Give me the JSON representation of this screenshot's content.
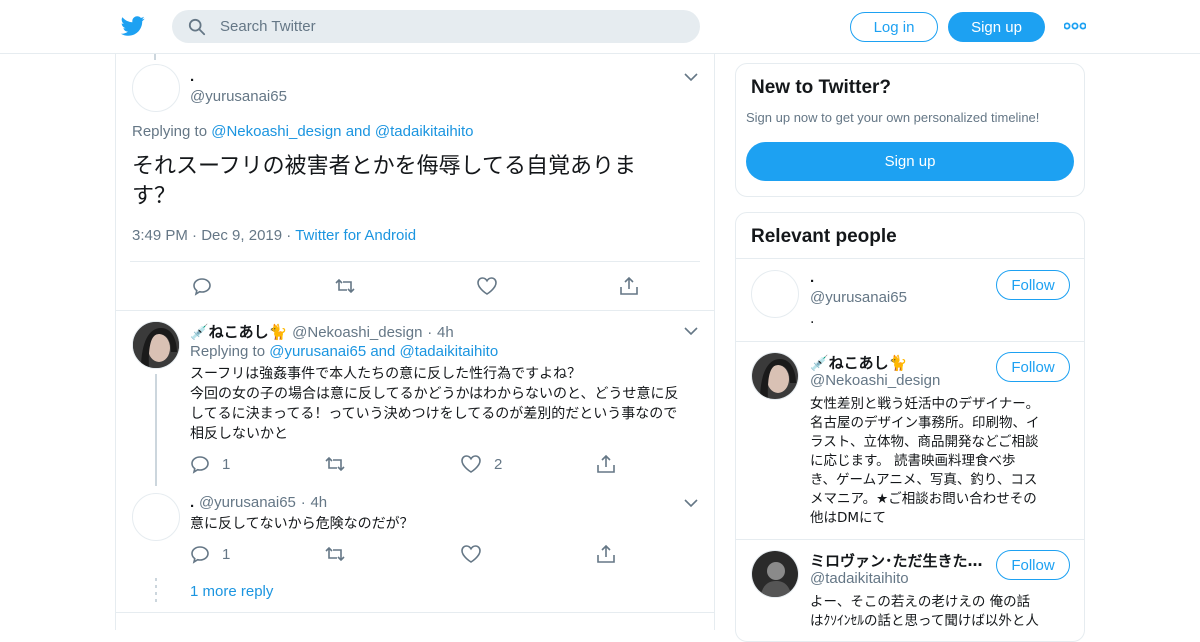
{
  "header": {
    "search_placeholder": "Search Twitter",
    "login_label": "Log in",
    "signup_label": "Sign up",
    "brand_color": "#1da1f2"
  },
  "focused_tweet": {
    "display_name": ".",
    "handle": "@yurusanai65",
    "replying_prefix": "Replying to",
    "replying_to_1": "@Nekoashi_design",
    "replying_and": "and",
    "replying_to_2": "@tadaikitaihito",
    "text": "それスーフリの被害者とかを侮辱してる自覚ありま\nす？",
    "time": "3:49 PM",
    "date": "Dec 9, 2019",
    "source": "Twitter for Android"
  },
  "replies": [
    {
      "display_name": "💉ねこあし🐈",
      "handle": "@Nekoashi_design",
      "age": "4h",
      "replying_prefix": "Replying to",
      "replying_to_1": "@yurusanai65",
      "replying_and": "and",
      "replying_to_2": "@tadaikitaihito",
      "text": "スーフリは強姦事件で本人たちの意に反した性行為ですよね？\n今回の女の子の場合は意に反してるかどうかはわからないのと、どうせ意に反してるに決まってる！っていう決めつけをしてるのが差別的だという事なので相反しないかと",
      "reply_count": "1",
      "like_count": "2"
    },
    {
      "display_name": ".",
      "handle": "@yurusanai65",
      "age": "4h",
      "text": "意に反してないから危険なのだが？",
      "reply_count": "1"
    }
  ],
  "more_replies_label": "1 more reply",
  "sidebar": {
    "new_title": "New to Twitter?",
    "new_subtitle": "Sign up now to get your own personalized timeline!",
    "signup_label": "Sign up",
    "relevant_title": "Relevant people",
    "people": [
      {
        "display_name": ".",
        "handle": "@yurusanai65",
        "bio": ".",
        "follow_label": "Follow"
      },
      {
        "display_name": "💉ねこあし🐈",
        "handle": "@Nekoashi_design",
        "bio": "女性差別と戦う妊活中のデザイナー。\n名古屋のデザイン事務所。印刷物、イ\nラスト、立体物、商品開発などご相談\nに応じます。 読書映画料理食べ歩\nき、ゲームアニメ、写真、釣り、コス\nメマニア。★ご相談お問い合わせその\n他はDMにて",
        "follow_label": "Follow"
      },
      {
        "display_name": "ミロヴァン･ただ生きた…",
        "handle": "@tadaikitaihito",
        "bio": "よー、そこの若えの老けえの 俺の話\nはｸｿｲﾝｾﾙの話と思って聞けば以外と人",
        "follow_label": "Follow"
      }
    ]
  }
}
